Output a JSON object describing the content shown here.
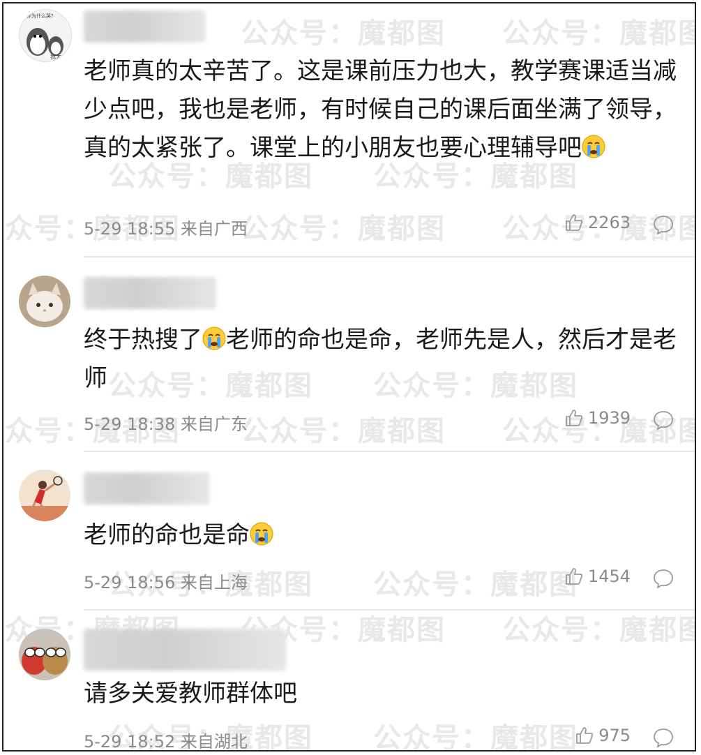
{
  "watermark": "公众号：魔都图",
  "comments": [
    {
      "avatar_caption_top": "你为什么哭?",
      "avatar_caption_bottom": "我太",
      "text": "老师真的太辛苦了。这是课前压力也大，教学赛课适当减少点吧，我也是老师，有时候自己的课后面坐满了领导，真的太紧张了。课堂上的小朋友也要心理辅导吧",
      "time": "5-29 18:55",
      "location": "来自广西",
      "likes": "2263"
    },
    {
      "text_before": "终于热搜了",
      "text_after": "老师的命也是命，老师先是人，然后才是老师",
      "time": "5-29 18:38",
      "location": "来自广东",
      "likes": "1939"
    },
    {
      "text": "老师的命也是命",
      "time": "5-29 18:56",
      "location": "来自上海",
      "likes": "1454"
    },
    {
      "text": "请多关爱教师群体吧",
      "time": "5-29 18:52",
      "location": "来自湖北",
      "likes": "975"
    }
  ],
  "icons": {
    "like": "thumbs-up-icon",
    "reply": "comment-bubble-icon",
    "emoji": "crying-face-emoji"
  },
  "colors": {
    "text": "#1a1a1a",
    "meta": "#8a8a8a",
    "divider": "#e6e6e6",
    "watermark": "#e8e8e8"
  }
}
